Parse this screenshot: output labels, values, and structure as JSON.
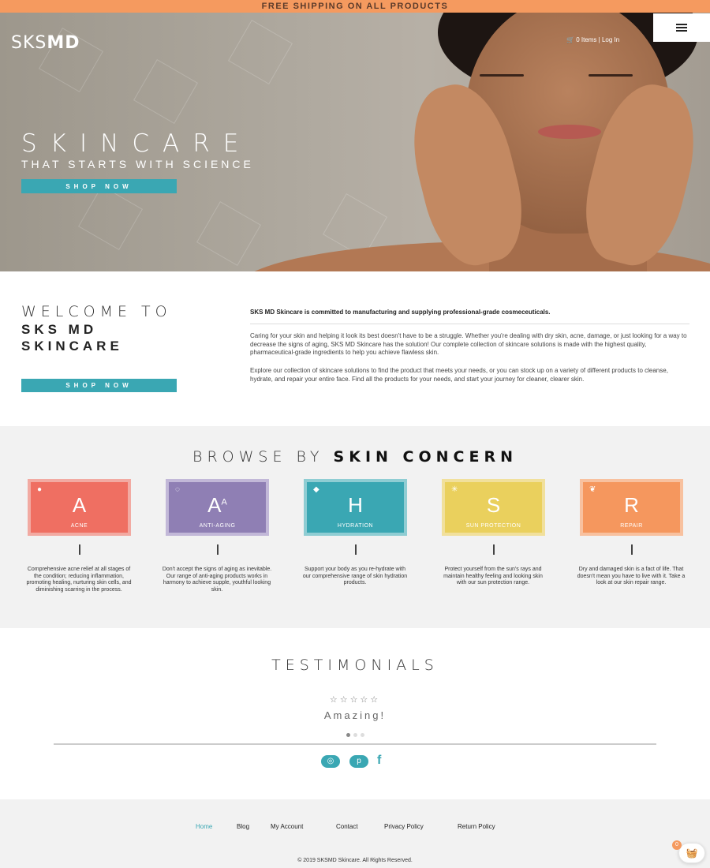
{
  "promo": {
    "text": "FREE SHIPPING ON ALL PRODUCTS"
  },
  "header": {
    "logo_light": "SKS",
    "logo_bold": "MD",
    "cart_text": "0 Items | Log In"
  },
  "hero": {
    "title": "SKINCARE",
    "subtitle": "THAT STARTS WITH SCIENCE",
    "cta": "SHOP NOW"
  },
  "welcome": {
    "line1": "WELCOME TO",
    "line2": "SKS MD",
    "line3": "SKINCARE",
    "cta": "SHOP NOW",
    "lead": "SKS MD Skincare is committed to manufacturing and supplying professional-grade cosmeceuticals.",
    "p1": "Caring for your skin and helping it look its best doesn't have to be a struggle. Whether you're dealing with dry skin, acne, damage, or just looking for a way to decrease the signs of aging, SKS MD Skincare has the solution! Our complete collection of skincare solutions is made with the highest quality, pharmaceutical-grade ingredients to help you achieve flawless skin.",
    "p2": "Explore our collection of skincare solutions to find the product that meets your needs, or you can stock up on a variety of different products to cleanse, hydrate, and repair your entire face. Find all the products for your needs, and start your journey for cleaner, clearer skin."
  },
  "concerns": {
    "title_light": "BROWSE BY",
    "title_bold": "SKIN CONCERN",
    "items": [
      {
        "letter": "A",
        "label": "ACNE",
        "color": "#ef6f62",
        "border": "#f2aaa2",
        "icon": "bubbles-icon",
        "desc": "Comprehensive acne relief at all stages of the condition; reducing inflammation, promoting healing, nurturing skin cells, and diminishing scarring in the process."
      },
      {
        "letter": "A",
        "sup": "A",
        "label": "ANTI-AGING",
        "color": "#8f7fb4",
        "border": "#c2b8d8",
        "icon": "clock-icon",
        "desc": "Don't accept the signs of aging as inevitable. Our range of anti-aging products works in harmony to achieve supple, youthful looking skin."
      },
      {
        "letter": "H",
        "label": "HYDRATION",
        "color": "#3aa7b3",
        "border": "#8fcdd3",
        "icon": "droplet-icon",
        "desc": "Support your body as you re-hydrate with our comprehensive range of skin hydration products."
      },
      {
        "letter": "S",
        "label": "SUN PROTECTION",
        "color": "#ead05d",
        "border": "#f1e09c",
        "icon": "sun-icon",
        "desc": "Protect yourself from the sun's rays and maintain healthy feeling and looking skin with our sun protection range."
      },
      {
        "letter": "R",
        "label": "REPAIR",
        "color": "#f5975e",
        "border": "#f8c19f",
        "icon": "leaf-icon",
        "desc": "Dry and damaged skin is a fact of life. That doesn't mean you have to live with it. Take a look at our skin repair range."
      }
    ]
  },
  "testimonials": {
    "title": "TESTIMONIALS",
    "stars": "☆☆☆☆☆",
    "quote": "Amazing!"
  },
  "social": {
    "instagram": "◎",
    "pinterest": "p",
    "facebook": "f"
  },
  "footer": {
    "nav": [
      "Home",
      "Blog",
      "My Account",
      "Contact",
      "Privacy Policy",
      "Return Policy"
    ],
    "copyright": "© 2019 SKSMD Skincare. All Rights Reserved."
  },
  "basket": {
    "count": "0"
  },
  "colors": {
    "accent": "#3aa7b3",
    "promo": "#f59a5f"
  }
}
